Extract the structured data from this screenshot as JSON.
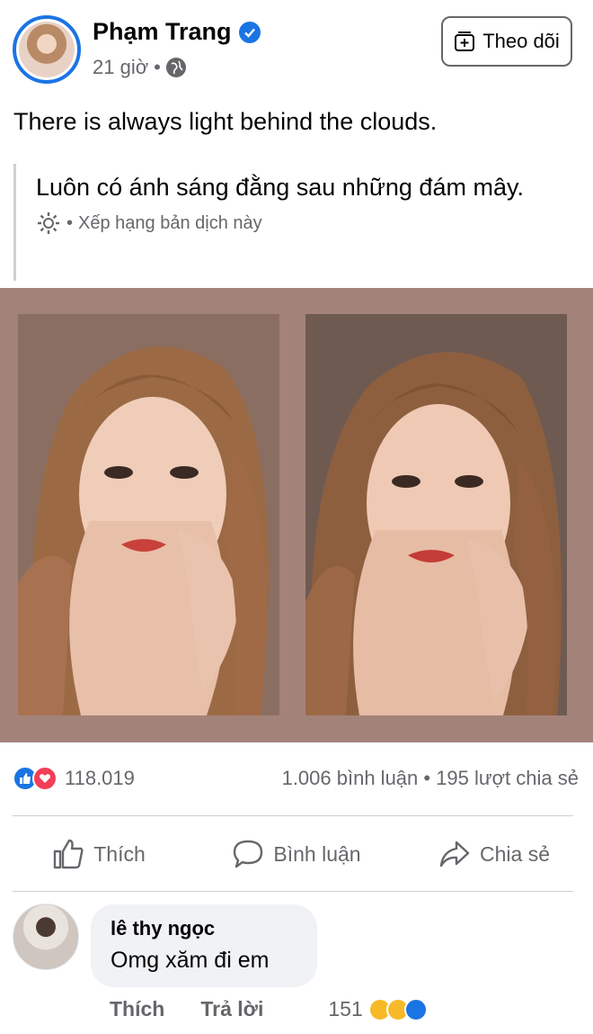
{
  "post": {
    "author": "Phạm Trang",
    "timestamp": "21 giờ",
    "separator": "•",
    "follow_label": "Theo dõi",
    "caption": "There is always light behind the clouds.",
    "translation": "Luôn có ánh sáng đằng sau những đám mây.",
    "translation_separator": "•",
    "rate_translation": "Xếp hạng bản dịch này"
  },
  "stats": {
    "reaction_count": "118.019",
    "comments_shares": "1.006 bình luận • 195 lượt chia sẻ"
  },
  "actions": {
    "like": "Thích",
    "comment": "Bình luận",
    "share": "Chia sẻ"
  },
  "comment": {
    "name": "lê thy ngọc",
    "text": "Omg xăm đi em",
    "like": "Thích",
    "reply": "Trả lời",
    "reaction_count": "151"
  },
  "icons": {
    "verified": "verified-badge-icon",
    "audience": "globe-icon",
    "follow": "follow-icon",
    "settings": "gear-icon",
    "like": "thumbs-up-icon",
    "comment": "comment-bubble-icon",
    "share": "share-arrow-icon"
  },
  "colors": {
    "accent": "#1b74e4",
    "love": "#f33e58",
    "secondary_text": "#65676b",
    "photo_backdrop": "#a38379"
  }
}
